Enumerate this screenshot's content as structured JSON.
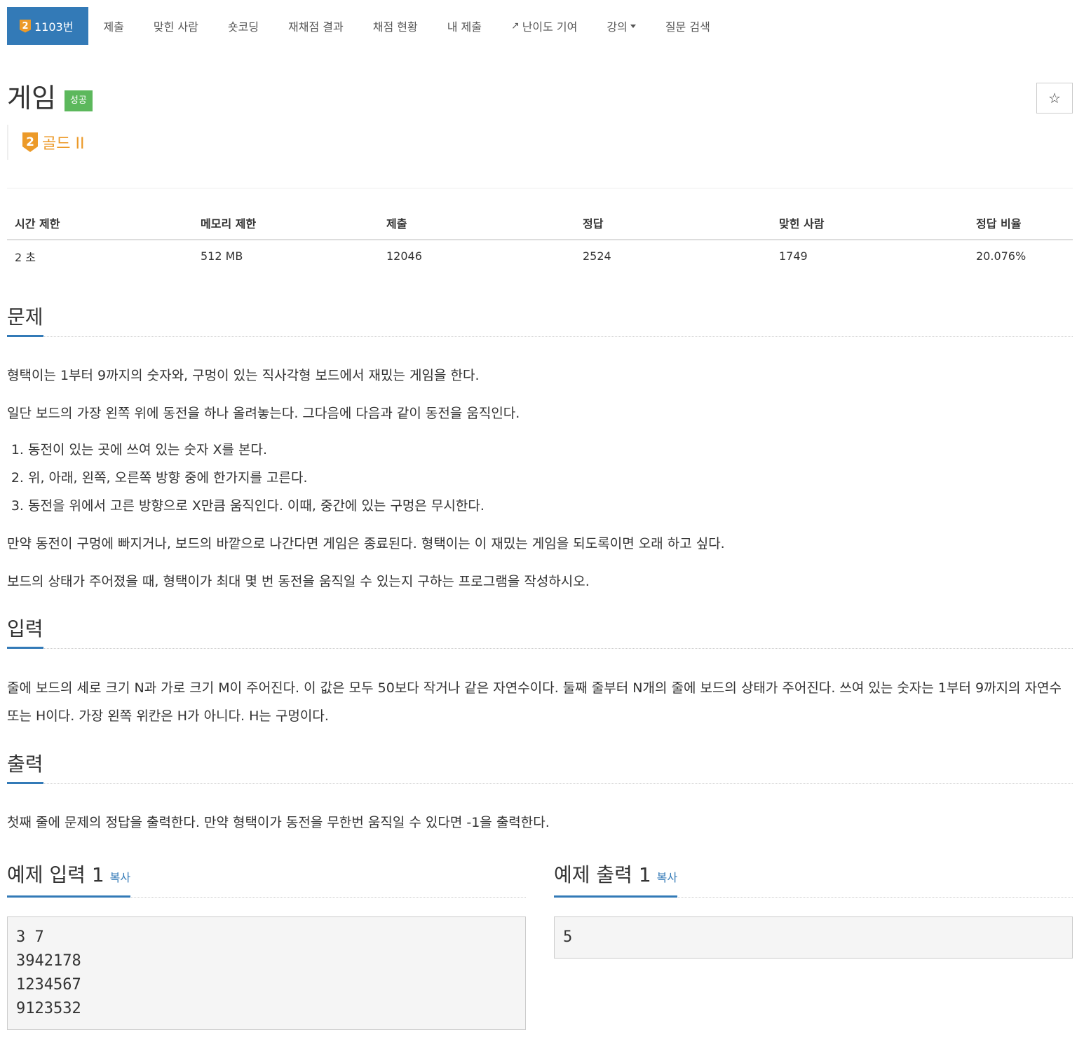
{
  "nav": {
    "problem_badge": "2",
    "problem_id": "1103번",
    "items": [
      "제출",
      "맞힌 사람",
      "숏코딩",
      "재채점 결과",
      "채점 현황",
      "내 제출",
      "난이도 기여",
      "강의",
      "질문 검색"
    ]
  },
  "problem": {
    "title": "게임",
    "status": "성공",
    "star": "☆",
    "tier_badge": "2",
    "tier": "골드 II"
  },
  "limits": {
    "headers": [
      "시간 제한",
      "메모리 제한",
      "제출",
      "정답",
      "맞힌 사람",
      "정답 비율"
    ],
    "values": [
      "2 초",
      "512 MB",
      "12046",
      "2524",
      "1749",
      "20.076%"
    ]
  },
  "sections": {
    "problem_head": "문제",
    "problem_p1": "형택이는 1부터 9까지의 숫자와, 구멍이 있는 직사각형 보드에서 재밌는 게임을 한다.",
    "problem_p2": "일단 보드의 가장 왼쪽 위에 동전을 하나 올려놓는다. 그다음에 다음과 같이 동전을 움직인다.",
    "steps": [
      "동전이 있는 곳에 쓰여 있는 숫자 X를 본다.",
      "위, 아래, 왼쪽, 오른쪽 방향 중에 한가지를 고른다.",
      "동전을 위에서 고른 방향으로 X만큼 움직인다. 이때, 중간에 있는 구멍은 무시한다."
    ],
    "problem_p3": "만약 동전이 구멍에 빠지거나, 보드의 바깥으로 나간다면 게임은 종료된다. 형택이는 이 재밌는 게임을 되도록이면 오래 하고 싶다.",
    "problem_p4": "보드의 상태가 주어졌을 때, 형택이가 최대 몇 번 동전을 움직일 수 있는지 구하는 프로그램을 작성하시오.",
    "input_head": "입력",
    "input_p": "줄에 보드의 세로 크기 N과 가로 크기 M이 주어진다. 이 값은 모두 50보다 작거나 같은 자연수이다. 둘째 줄부터 N개의 줄에 보드의 상태가 주어진다. 쓰여 있는 숫자는 1부터 9까지의 자연수 또는 H이다. 가장 왼쪽 위칸은 H가 아니다. H는 구멍이다.",
    "output_head": "출력",
    "output_p": "첫째 줄에 문제의 정답을 출력한다. 만약 형택이가 동전을 무한번 움직일 수 있다면 -1을 출력한다."
  },
  "examples": {
    "input_head": "예제 입력 1",
    "output_head": "예제 출력 1",
    "copy": "복사",
    "input_body": "3 7\n3942178\n1234567\n9123532",
    "output_body": "5"
  }
}
